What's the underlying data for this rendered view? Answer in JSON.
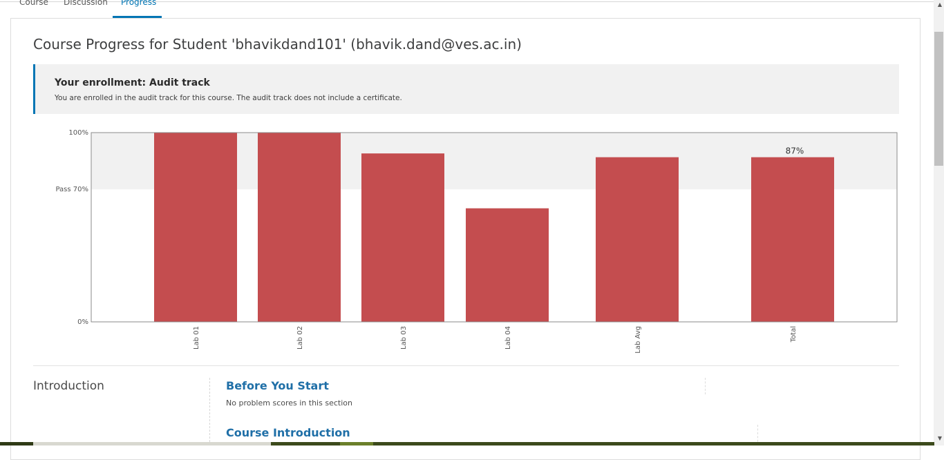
{
  "tabs": [
    {
      "label": "Course",
      "active": false
    },
    {
      "label": "Discussion",
      "active": false
    },
    {
      "label": "Progress",
      "active": true
    }
  ],
  "page": {
    "title": "Course Progress for Student 'bhavikdand101' (bhavik.dand@ves.ac.in)"
  },
  "enrollment": {
    "title": "Your enrollment: Audit track",
    "message": "You are enrolled in the audit track for this course. The audit track does not include a certificate."
  },
  "chart_data": {
    "type": "bar",
    "categories": [
      "Lab 01",
      "Lab 02",
      "Lab 03",
      "Lab 04",
      "Lab Avg",
      "Total"
    ],
    "values": [
      100,
      100,
      89,
      60,
      87,
      87
    ],
    "annotations": [
      {
        "category": "Total",
        "text": "87%"
      }
    ],
    "yticks": [
      {
        "value": 0,
        "label": "0%"
      },
      {
        "value": 70,
        "label": "Pass 70%"
      },
      {
        "value": 100,
        "label": "100%"
      }
    ],
    "ylim": [
      0,
      100
    ],
    "pass_threshold": 70,
    "bar_color": "#c44d4f",
    "pass_band_color": "#f1f1f1"
  },
  "chapter": {
    "title": "Introduction",
    "sections": [
      {
        "title": "Before You Start",
        "note": "No problem scores in this section"
      },
      {
        "title": "Course Introduction",
        "note": ""
      }
    ]
  },
  "colors": {
    "accent": "#0075b4",
    "link": "#1f6fa7",
    "bar": "#c44d4f"
  }
}
